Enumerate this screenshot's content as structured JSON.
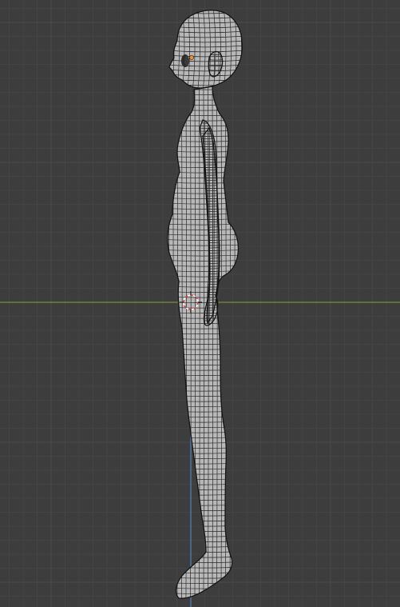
{
  "viewport": {
    "view": "side-orthographic",
    "background_color": "#3d3d3d",
    "grid_minor_color": "#444444",
    "grid_major_color": "#4a4a4a",
    "axis_horizontal_color": "#7da536",
    "axis_vertical_color": "#4f8fd8",
    "mesh_fill_color": "#b8b8b8",
    "mesh_wire_color": "#2a2a2a",
    "origin_color": "#f29425",
    "cursor_color": "#e03a3a",
    "objects": [
      {
        "name": "character-body",
        "type": "mesh",
        "icon": "mesh-icon"
      }
    ],
    "tools": [
      {
        "name": "3d-cursor",
        "icon": "crosshair-icon"
      }
    ]
  }
}
